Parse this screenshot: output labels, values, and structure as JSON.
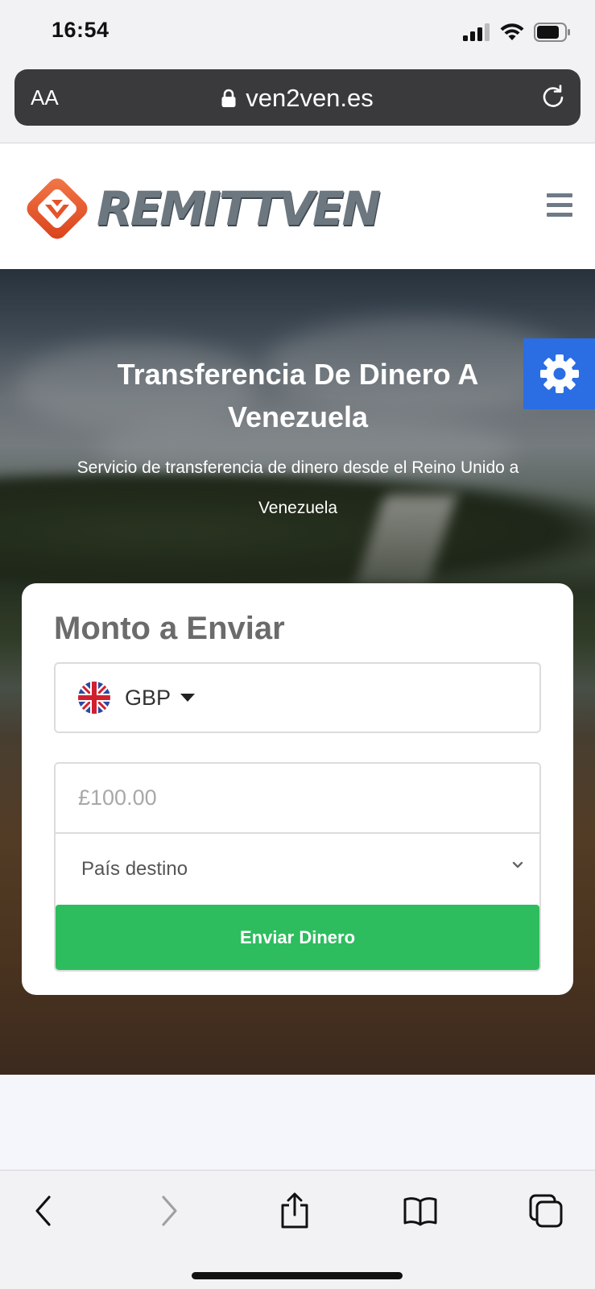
{
  "status_bar": {
    "time": "16:54"
  },
  "browser": {
    "text_size_label": "AA",
    "url": "ven2ven.es"
  },
  "site": {
    "logo_text": "REMITTVEN"
  },
  "hero": {
    "title": "Transferencia De Dinero A Venezuela",
    "subtitle": "Servicio de transferencia de dinero desde el Reino Unido a Venezuela"
  },
  "form": {
    "heading": "Monto a Enviar",
    "currency": "GBP",
    "amount_placeholder": "£100.00",
    "country_placeholder": "País destino",
    "submit_label": "Enviar Dinero"
  },
  "colors": {
    "accent_blue": "#2b6de3",
    "success_green": "#2dbd5f",
    "logo_orange": "#e5532a",
    "logo_gray": "#6c7780"
  },
  "icons": {
    "lock": "lock-icon",
    "reload": "reload-icon",
    "menu": "hamburger-menu-icon",
    "settings": "gear-icon",
    "flag": "uk-flag-icon",
    "back": "chevron-left-icon",
    "forward": "chevron-right-icon",
    "share": "share-icon",
    "bookmarks": "book-icon",
    "tabs": "tabs-icon"
  }
}
